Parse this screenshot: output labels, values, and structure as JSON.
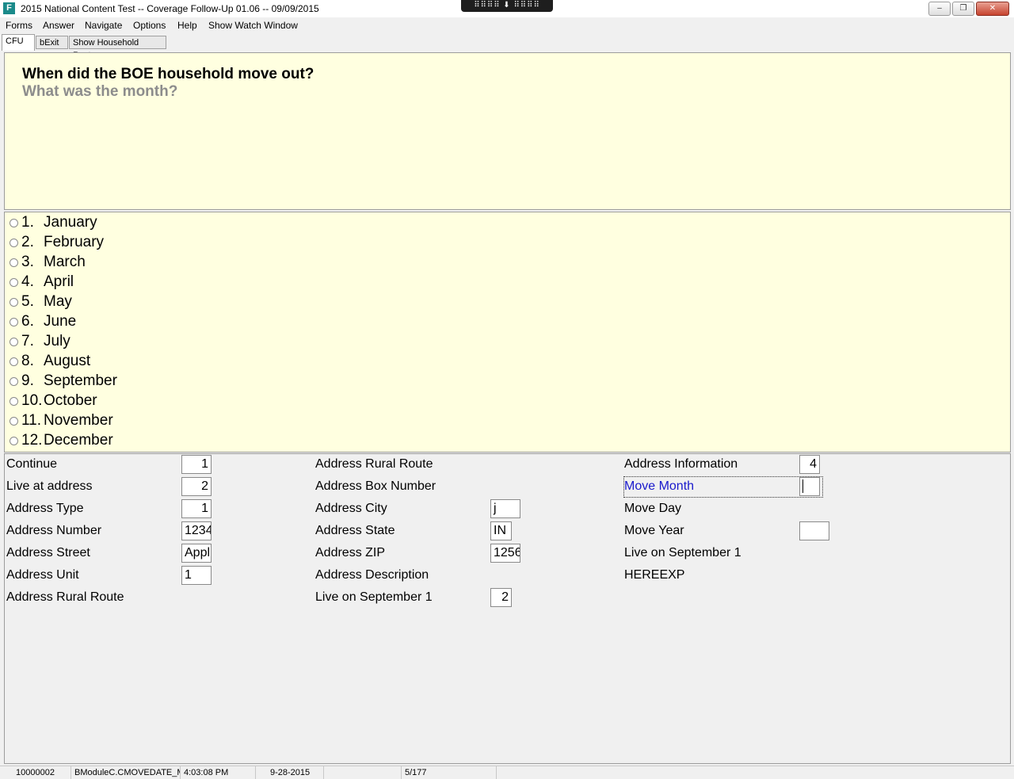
{
  "window": {
    "title": "2015 National Content Test -- Coverage Follow-Up 01.06 -- 09/09/2015",
    "app_icon": "F",
    "pin_bar": "⠿⠿⠿⠿ ⬇ ⠿⠿⠿⠿",
    "minimize": "–",
    "maximize": "❐",
    "close": "✕"
  },
  "menu": [
    "Forms",
    "Answer",
    "Navigate",
    "Options",
    "Help",
    "Show Watch Window"
  ],
  "tabs": [
    "CFU",
    "bExit",
    "Show Household Roster"
  ],
  "question": {
    "main": "When did the BOE household move out?",
    "sub": "What was the month?"
  },
  "options": [
    {
      "num": "1.",
      "label": "January"
    },
    {
      "num": "2.",
      "label": "February"
    },
    {
      "num": "3.",
      "label": "March"
    },
    {
      "num": "4.",
      "label": "April"
    },
    {
      "num": "5.",
      "label": "May"
    },
    {
      "num": "6.",
      "label": "June"
    },
    {
      "num": "7.",
      "label": "July"
    },
    {
      "num": "8.",
      "label": "August"
    },
    {
      "num": "9.",
      "label": "September"
    },
    {
      "num": "10.",
      "label": "October"
    },
    {
      "num": "11.",
      "label": "November"
    },
    {
      "num": "12.",
      "label": "December"
    }
  ],
  "fields": {
    "col1": [
      {
        "label": "Continue",
        "value": "1"
      },
      {
        "label": "Live at address",
        "value": "2"
      },
      {
        "label": "Address Type",
        "value": "1"
      },
      {
        "label": "Address Number",
        "value": "1234"
      },
      {
        "label": "Address Street",
        "value": "Appl"
      },
      {
        "label": "Address Unit",
        "value": "1"
      },
      {
        "label": "Address Rural Route"
      }
    ],
    "col2": [
      {
        "label": "Address Rural Route"
      },
      {
        "label": "Address Box Number"
      },
      {
        "label": "Address City",
        "value": "j"
      },
      {
        "label": "Address State",
        "value": "IN"
      },
      {
        "label": "Address ZIP",
        "value": "1256"
      },
      {
        "label": "Address Description"
      },
      {
        "label": "Live on September 1",
        "value": "2"
      }
    ],
    "col3": [
      {
        "label": "Address Information",
        "value": "4"
      },
      {
        "label": "Move Month",
        "value": ""
      },
      {
        "label": "Move Day"
      },
      {
        "label": "Move Year",
        "value": ""
      },
      {
        "label": "Live on September 1"
      },
      {
        "label": "HEREEXP"
      }
    ]
  },
  "status": {
    "case_id": "10000002",
    "field": "BModuleC.CMOVEDATE_M",
    "time": "4:03:08 PM",
    "date": "9-28-2015",
    "extra": "",
    "page": "5/177"
  }
}
